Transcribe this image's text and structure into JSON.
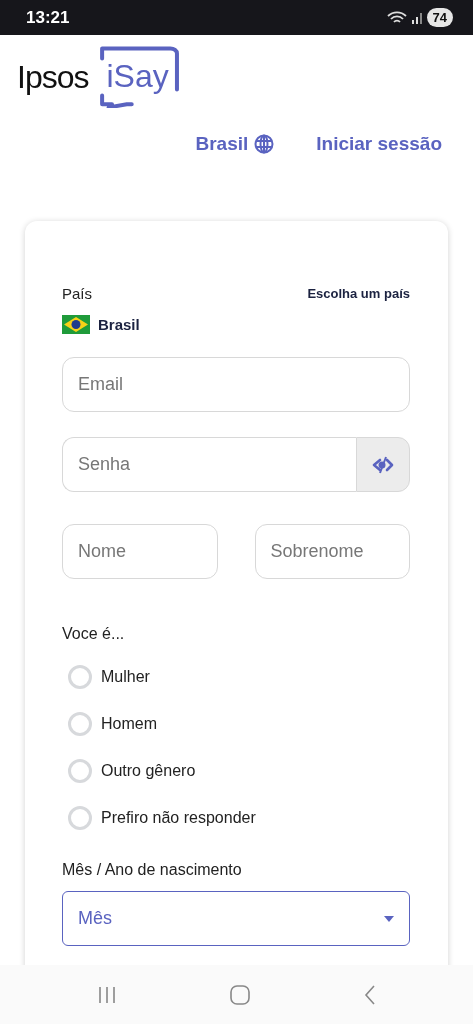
{
  "status_bar": {
    "time": "13:21",
    "battery": "74"
  },
  "header": {
    "logo_left": "Ipsos",
    "logo_right": "iSay",
    "country_link": "Brasil",
    "login_link": "Iniciar sessão"
  },
  "form": {
    "country_label": "País",
    "choose_country_link": "Escolha um país",
    "country_value": "Brasil",
    "email": {
      "placeholder": "Email"
    },
    "password": {
      "placeholder": "Senha"
    },
    "first_name": {
      "placeholder": "Nome"
    },
    "last_name": {
      "placeholder": "Sobrenome"
    },
    "gender": {
      "label": "Voce é...",
      "options": [
        {
          "label": "Mulher",
          "selected": false
        },
        {
          "label": "Homem",
          "selected": false
        },
        {
          "label": "Outro gênero",
          "selected": false
        },
        {
          "label": "Prefiro não responder",
          "selected": false
        }
      ]
    },
    "birth": {
      "label": "Mês / Ano de nascimento",
      "month_select": {
        "placeholder": "Mês"
      }
    }
  }
}
